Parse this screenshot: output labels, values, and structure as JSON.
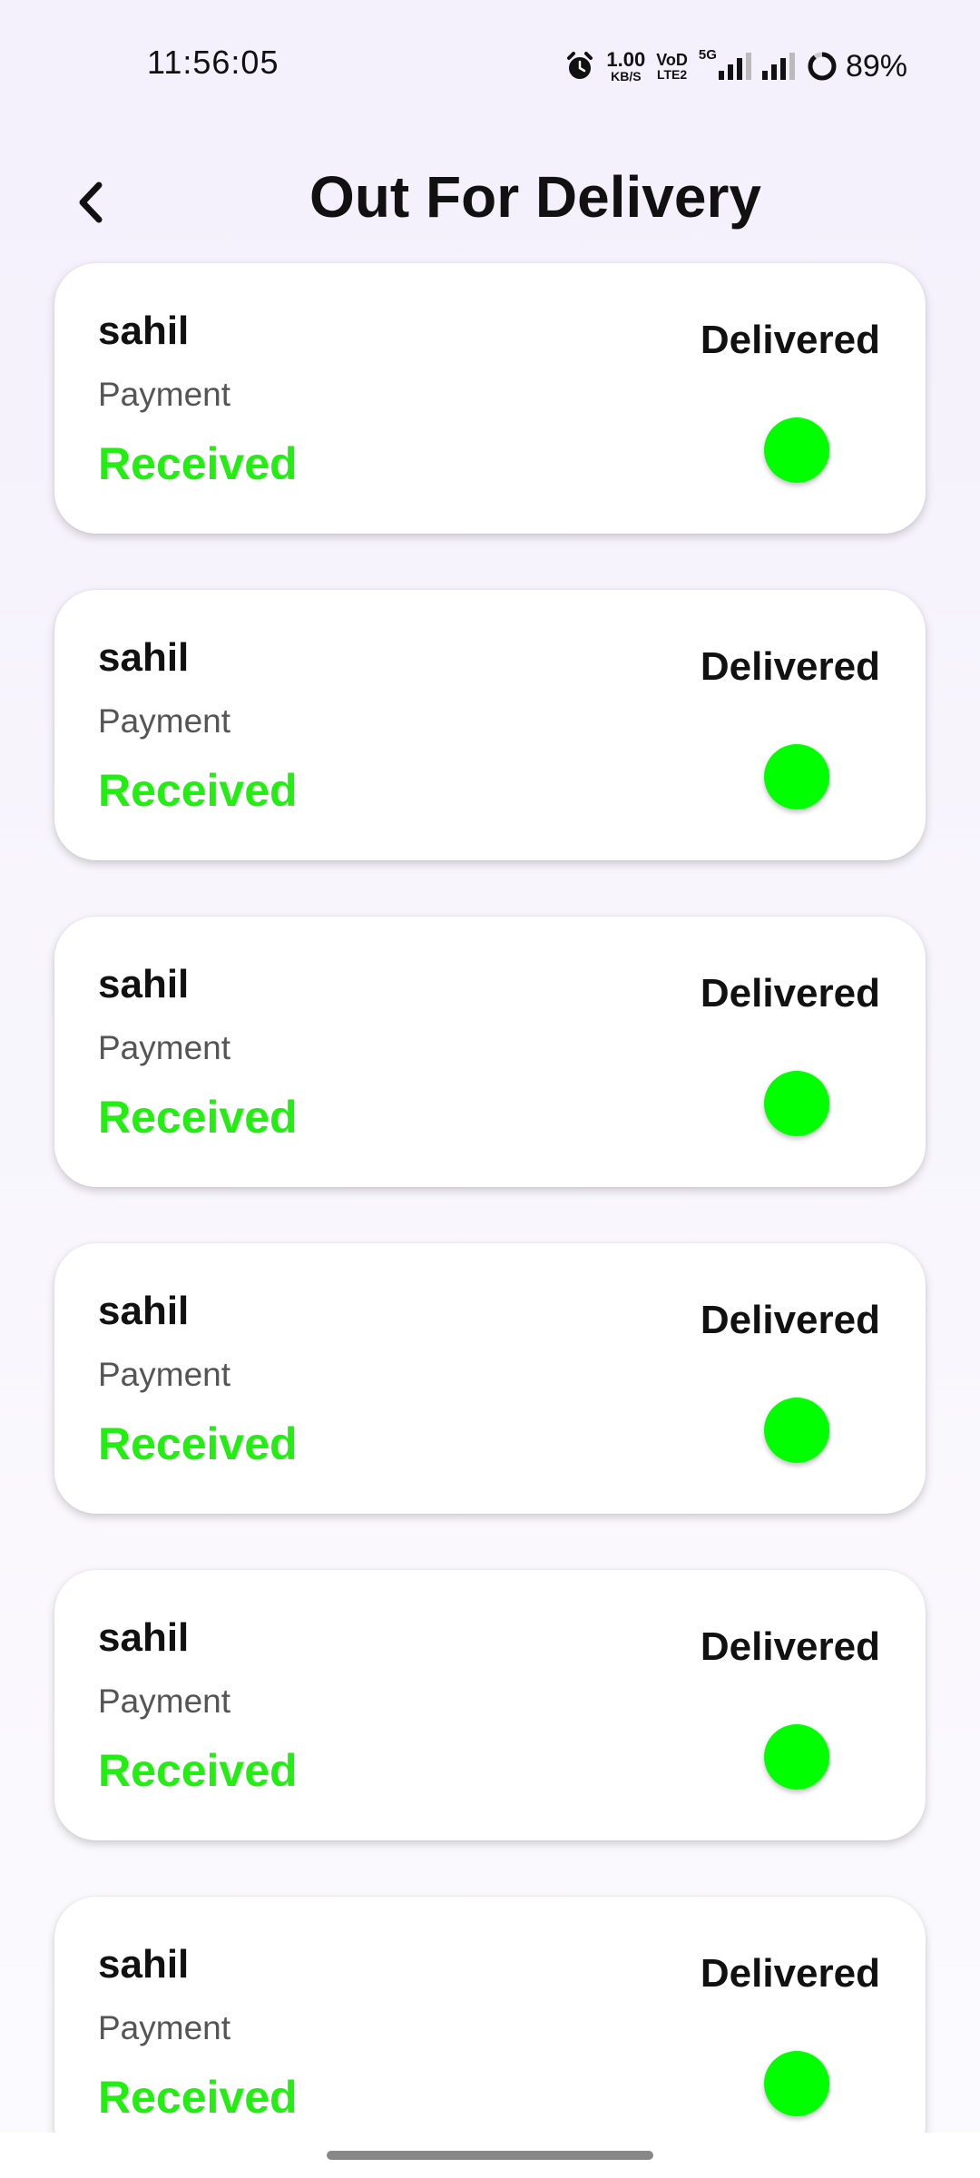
{
  "status_bar": {
    "time": "11:56:05",
    "net_speed_value": "1.00",
    "net_speed_unit": "KB/S",
    "volte_top": "VoD",
    "volte_bottom": "LTE2",
    "net_type": "5G",
    "battery": "89%"
  },
  "header": {
    "title": "Out For Delivery"
  },
  "orders": [
    {
      "name": "sahil",
      "payment_label": "Payment",
      "payment_status": "Received",
      "delivery_status": "Delivered"
    },
    {
      "name": "sahil",
      "payment_label": "Payment",
      "payment_status": "Received",
      "delivery_status": "Delivered"
    },
    {
      "name": "sahil",
      "payment_label": "Payment",
      "payment_status": "Received",
      "delivery_status": "Delivered"
    },
    {
      "name": "sahil",
      "payment_label": "Payment",
      "payment_status": "Received",
      "delivery_status": "Delivered"
    },
    {
      "name": "sahil",
      "payment_label": "Payment",
      "payment_status": "Received",
      "delivery_status": "Delivered"
    },
    {
      "name": "sahil",
      "payment_label": "Payment",
      "payment_status": "Received",
      "delivery_status": "Delivered"
    }
  ],
  "colors": {
    "payment_status": "#22ee11",
    "status_dot": "#00ff00",
    "background": "#f4f0fc"
  }
}
